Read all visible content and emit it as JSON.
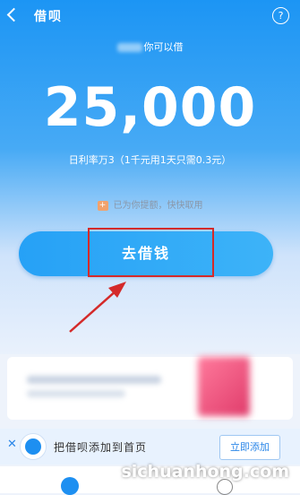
{
  "header": {
    "title": "借呗"
  },
  "user_greeting": "你可以借",
  "amount": "25,000",
  "rate_text": "日利率万3（1千元用1天只需0.3元）",
  "gift": {
    "icon": "gift-icon",
    "text": "已为你提额，快快取用"
  },
  "borrow_button": "去借钱",
  "banner": {
    "text": "把借呗添加到首页",
    "add_button": "立即添加"
  },
  "watermark": "sichuanhong.com",
  "colors": {
    "primary": "#1c95f4",
    "highlight": "#d42a2a"
  }
}
